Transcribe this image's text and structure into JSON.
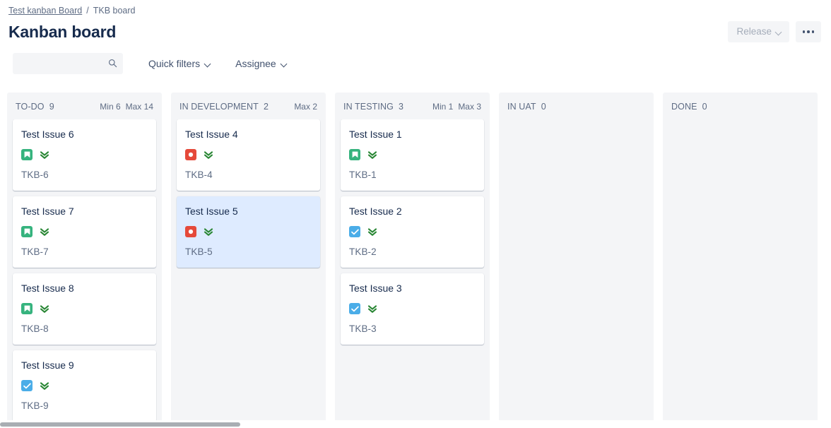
{
  "breadcrumb": {
    "parent": "Test kanban Board",
    "separator": "/",
    "current": "TKB board"
  },
  "header": {
    "title": "Kanban board",
    "release_label": "Release",
    "release_icon": "chevron-down-icon",
    "more_icon": "ellipsis-icon"
  },
  "filters": {
    "search_value": "",
    "search_placeholder": "",
    "search_icon": "search-icon",
    "quick_filters_label": "Quick filters",
    "assignee_label": "Assignee",
    "chevron_icon": "chevron-down-icon"
  },
  "colors": {
    "story": "#36b37e",
    "bug": "#e5493a",
    "task": "#4bade8",
    "priority_lowest": "#2a8735",
    "card_selected": "#deebff",
    "column_bg": "#f4f5f7",
    "text_primary": "#172b4d",
    "text_subtle": "#5e6c84"
  },
  "board": {
    "columns": [
      {
        "name": "TO-DO",
        "count": "9",
        "min_label": "Min 6",
        "max_label": "Max 14",
        "cards": [
          {
            "summary": "Test Issue 6",
            "key": "TKB-6",
            "type": "story",
            "type_icon": "story-icon",
            "priority": "lowest",
            "priority_icon": "priority-lowest-icon",
            "selected": false
          },
          {
            "summary": "Test Issue 7",
            "key": "TKB-7",
            "type": "story",
            "type_icon": "story-icon",
            "priority": "lowest",
            "priority_icon": "priority-lowest-icon",
            "selected": false
          },
          {
            "summary": "Test Issue 8",
            "key": "TKB-8",
            "type": "story",
            "type_icon": "story-icon",
            "priority": "lowest",
            "priority_icon": "priority-lowest-icon",
            "selected": false
          },
          {
            "summary": "Test Issue 9",
            "key": "TKB-9",
            "type": "task",
            "type_icon": "task-icon",
            "priority": "lowest",
            "priority_icon": "priority-lowest-icon",
            "selected": false
          }
        ]
      },
      {
        "name": "IN DEVELOPMENT",
        "count": "2",
        "min_label": "",
        "max_label": "Max 2",
        "cards": [
          {
            "summary": "Test Issue 4",
            "key": "TKB-4",
            "type": "bug",
            "type_icon": "bug-icon",
            "priority": "lowest",
            "priority_icon": "priority-lowest-icon",
            "selected": false
          },
          {
            "summary": "Test Issue 5",
            "key": "TKB-5",
            "type": "bug",
            "type_icon": "bug-icon",
            "priority": "lowest",
            "priority_icon": "priority-lowest-icon",
            "selected": true
          }
        ]
      },
      {
        "name": "IN TESTING",
        "count": "3",
        "min_label": "Min 1",
        "max_label": "Max 3",
        "cards": [
          {
            "summary": "Test Issue 1",
            "key": "TKB-1",
            "type": "story",
            "type_icon": "story-icon",
            "priority": "lowest",
            "priority_icon": "priority-lowest-icon",
            "selected": false
          },
          {
            "summary": "Test Issue 2",
            "key": "TKB-2",
            "type": "task",
            "type_icon": "task-icon",
            "priority": "lowest",
            "priority_icon": "priority-lowest-icon",
            "selected": false
          },
          {
            "summary": "Test Issue 3",
            "key": "TKB-3",
            "type": "task",
            "type_icon": "task-icon",
            "priority": "lowest",
            "priority_icon": "priority-lowest-icon",
            "selected": false
          }
        ]
      },
      {
        "name": "IN UAT",
        "count": "0",
        "min_label": "",
        "max_label": "",
        "cards": []
      },
      {
        "name": "DONE",
        "count": "0",
        "min_label": "",
        "max_label": "",
        "cards": []
      }
    ]
  }
}
